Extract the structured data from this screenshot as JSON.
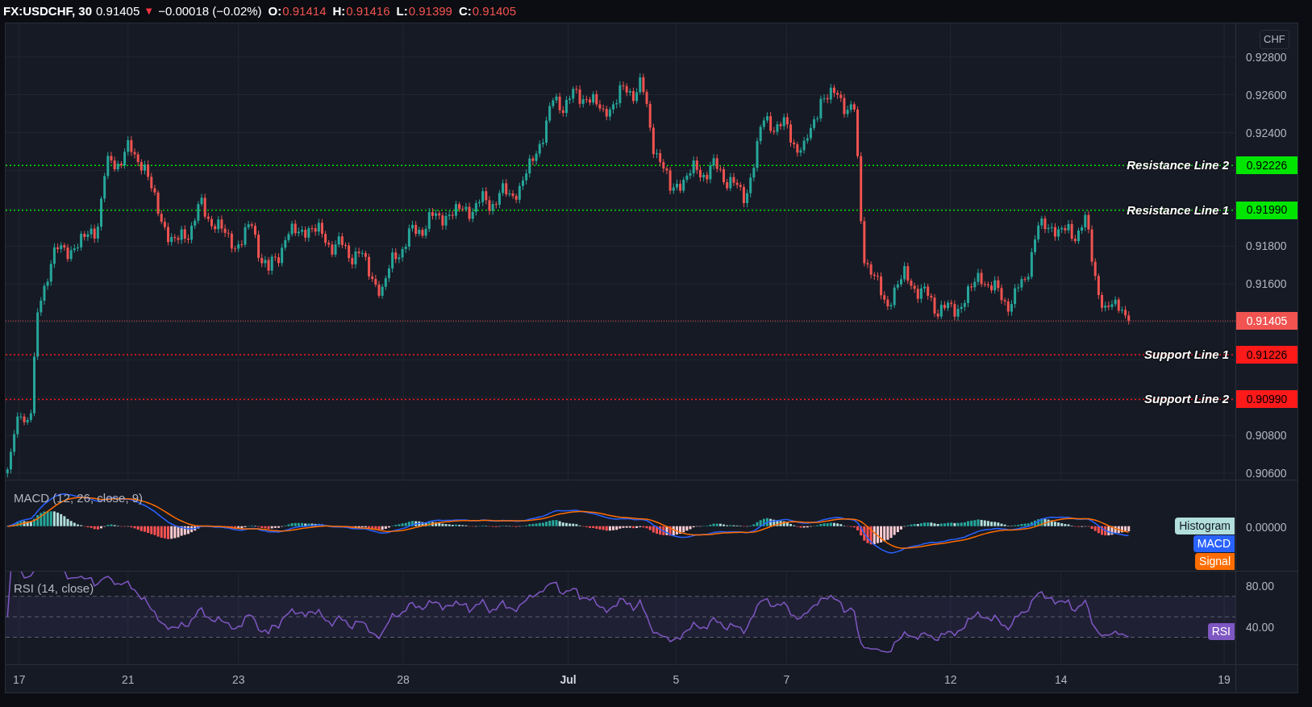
{
  "legend": {
    "symbol": "FX:USDCHF, 30",
    "last": "0.91405",
    "arrow": "▼",
    "change": "−0.00018 (−0.02%)",
    "ohlc": [
      {
        "key": "O:",
        "value": "0.91414"
      },
      {
        "key": "H:",
        "value": "0.91416"
      },
      {
        "key": "L:",
        "value": "0.91399"
      },
      {
        "key": "C:",
        "value": "0.91405"
      }
    ]
  },
  "price_axis": {
    "currency": "CHF",
    "ticks": [
      "0.92800",
      "0.92600",
      "0.92400",
      "0.91800",
      "0.91600",
      "0.90800",
      "0.90600"
    ]
  },
  "levels": [
    {
      "label": "Resistance Line 2",
      "price": "0.92226",
      "color": "#00e600"
    },
    {
      "label": "Resistance Line 1",
      "price": "0.91990",
      "color": "#00e600"
    },
    {
      "label": "Support Line 1",
      "price": "0.91226",
      "color": "#ff1a1a"
    },
    {
      "label": "Support Line 2",
      "price": "0.90990",
      "color": "#ff1a1a"
    }
  ],
  "last_price_tag": "0.91405",
  "macd_pane": {
    "title": "MACD (12, 26, close, 9)",
    "axis_tick": "0.00000",
    "tags": [
      {
        "label": "Histogram",
        "color": "#b2dfdb"
      },
      {
        "label": "MACD",
        "color": "#2962ff"
      },
      {
        "label": "Signal",
        "color": "#ff6d00"
      }
    ]
  },
  "rsi_pane": {
    "title": "RSI (14, close)",
    "axis_ticks": [
      "80.00",
      "40.00"
    ],
    "tag": {
      "label": "RSI",
      "color": "#7e57c2"
    }
  },
  "time_axis": [
    "17",
    "21",
    "23",
    "28",
    "Jul",
    "5",
    "7",
    "12",
    "14",
    "19"
  ]
}
